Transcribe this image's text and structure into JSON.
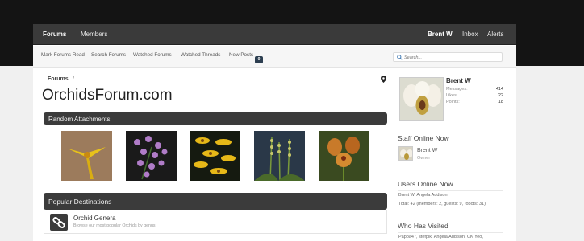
{
  "nav": {
    "forums": "Forums",
    "members": "Members",
    "user": "Brent W",
    "inbox": "Inbox",
    "alerts": "Alerts"
  },
  "subnav": {
    "mark_read": "Mark Forums Read",
    "search_forums": "Search Forums",
    "watched_forums": "Watched Forums",
    "watched_threads": "Watched Threads",
    "new_posts": "New Posts",
    "new_posts_badge": "0"
  },
  "search": {
    "placeholder": "Search..."
  },
  "breadcrumb": {
    "forums": "Forums",
    "separator": "/"
  },
  "site_title": "OrchidsForum.com",
  "random_attachments": {
    "title": "Random Attachments"
  },
  "popular": {
    "title": "Popular Destinations",
    "items": [
      {
        "title": "Orchid Genera",
        "description": "Browse our most popular Orchids by genus."
      }
    ]
  },
  "sidebar": {
    "user": {
      "name": "Brent W",
      "stats": [
        {
          "label": "Messages:",
          "value": "414"
        },
        {
          "label": "Likes:",
          "value": "22"
        },
        {
          "label": "Points:",
          "value": "18"
        }
      ]
    },
    "staff_online": {
      "title": "Staff Online Now",
      "members": [
        {
          "name": "Brent W",
          "role": "Owner"
        }
      ]
    },
    "users_online": {
      "title": "Users Online Now",
      "names": "Brent W, Angela Addison",
      "totals": "Total: 42 (members: 2, guests: 9, robots: 31)"
    },
    "visited": {
      "title": "Who Has Visited",
      "names": "Pappa47, stefpik, Angela Addison, CK Yeo,"
    }
  },
  "colors": {
    "nav_bg": "#3a3a3a",
    "section_bar": "#3b3b3b",
    "header_band": "#141414"
  }
}
